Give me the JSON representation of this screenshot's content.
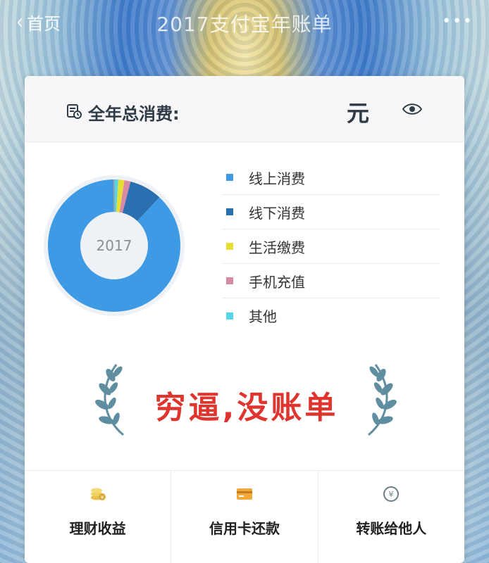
{
  "header": {
    "back_label": "首页",
    "title": "2017支付宝年账单",
    "more_label": "•••"
  },
  "summary": {
    "total_label": "全年总消费:",
    "unit": "元"
  },
  "chart": {
    "center_label": "2017"
  },
  "chart_data": {
    "type": "pie",
    "categories": [
      "线上消费",
      "线下消费",
      "生活缴费",
      "手机充值",
      "其他"
    ],
    "values": [
      88,
      8,
      1.5,
      1.5,
      1
    ],
    "colors": [
      "#3f9ae6",
      "#2a6faf",
      "#e8df36",
      "#d98aa2",
      "#53d6e6"
    ]
  },
  "legend": [
    {
      "label": "线上消费",
      "color": "#3f9ae6"
    },
    {
      "label": "线下消费",
      "color": "#2a6faf"
    },
    {
      "label": "生活缴费",
      "color": "#e8df36"
    },
    {
      "label": "手机充值",
      "color": "#d98aa2"
    },
    {
      "label": "其他",
      "color": "#53d6e6"
    }
  ],
  "slogan": "穷逼,没账单",
  "bottom_nav": [
    {
      "label": "理财收益",
      "icon": "coins-icon"
    },
    {
      "label": "信用卡还款",
      "icon": "credit-card-icon"
    },
    {
      "label": "转账给他人",
      "icon": "transfer-icon"
    }
  ]
}
